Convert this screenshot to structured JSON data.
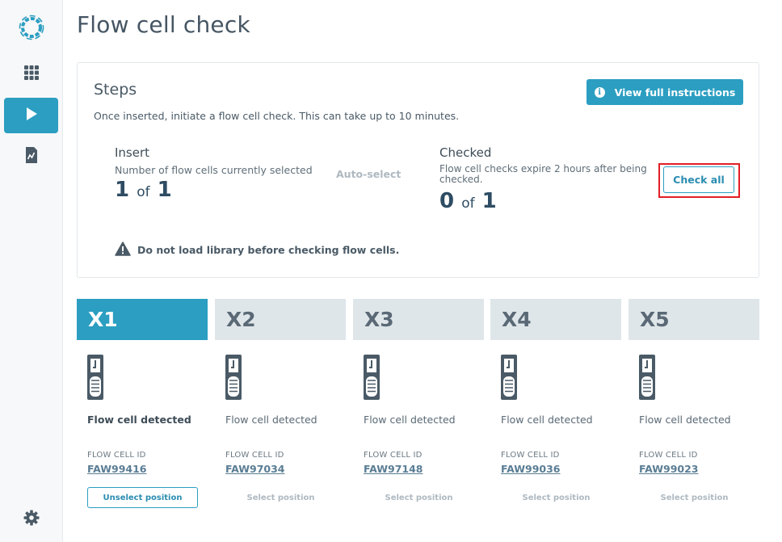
{
  "page": {
    "title": "Flow cell check"
  },
  "sidebar": {
    "items": [
      {
        "name": "apps",
        "icon": "grid-icon",
        "active": false
      },
      {
        "name": "run",
        "icon": "play-icon",
        "active": true
      },
      {
        "name": "reports",
        "icon": "report-icon",
        "active": false
      }
    ],
    "settings_icon": "gear-icon"
  },
  "steps": {
    "title": "Steps",
    "description": "Once inserted, initiate a flow cell check. This can take up to 10 minutes.",
    "view_instructions_label": "View full instructions",
    "insert": {
      "title": "Insert",
      "description": "Number of flow cells currently selected",
      "count": "1",
      "of_label": "of",
      "total": "1",
      "auto_select_label": "Auto-select"
    },
    "checked": {
      "title": "Checked",
      "description": "Flow cell checks expire 2 hours after being checked.",
      "count": "0",
      "of_label": "of",
      "total": "1",
      "check_all_label": "Check all"
    },
    "warning": "Do not load library before checking flow cells."
  },
  "positions": [
    {
      "label": "X1",
      "status": "Flow cell detected",
      "id_label": "FLOW CELL ID",
      "id": "FAW99416",
      "action": "Unselect position",
      "selected": true
    },
    {
      "label": "X2",
      "status": "Flow cell detected",
      "id_label": "FLOW CELL ID",
      "id": "FAW97034",
      "action": "Select position",
      "selected": false
    },
    {
      "label": "X3",
      "status": "Flow cell detected",
      "id_label": "FLOW CELL ID",
      "id": "FAW97148",
      "action": "Select position",
      "selected": false
    },
    {
      "label": "X4",
      "status": "Flow cell detected",
      "id_label": "FLOW CELL ID",
      "id": "FAW99036",
      "action": "Select position",
      "selected": false
    },
    {
      "label": "X5",
      "status": "Flow cell detected",
      "id_label": "FLOW CELL ID",
      "id": "FAW99023",
      "action": "Select position",
      "selected": false
    }
  ],
  "colors": {
    "accent": "#2b9ec1",
    "highlight_outline": "#e21e26",
    "header_inactive": "#dfe6ea"
  }
}
